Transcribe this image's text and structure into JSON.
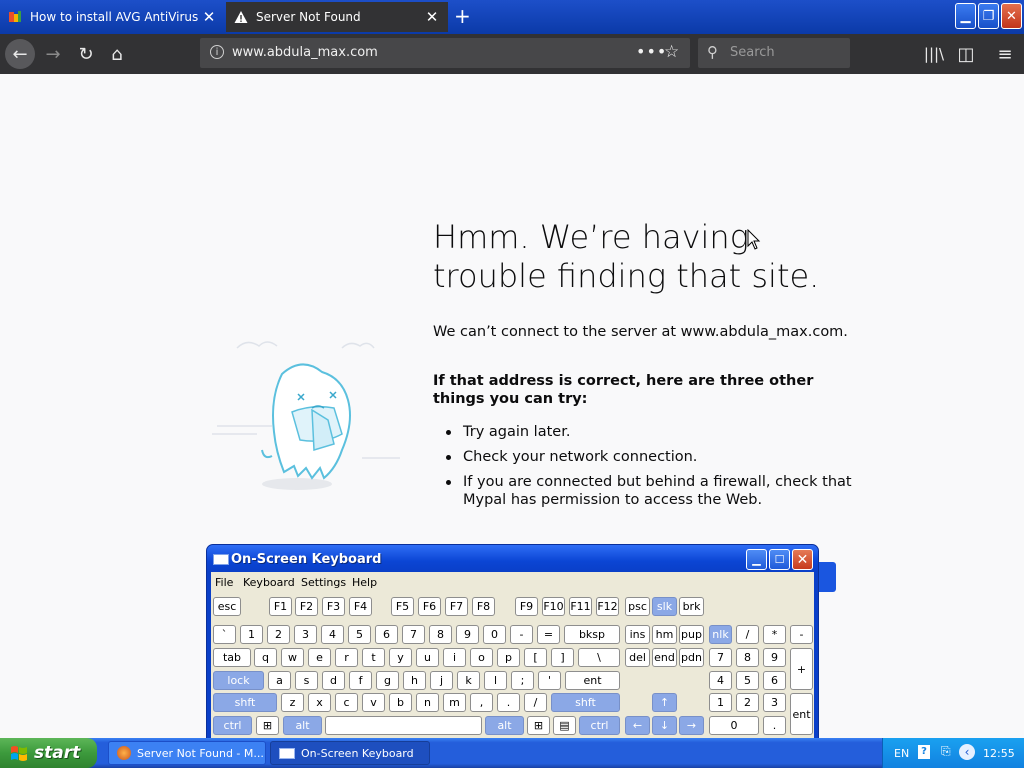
{
  "browser": {
    "tabs": [
      {
        "label": "How to install AVG AntiVirus | AVG",
        "active": false,
        "icon": "avg-favicon-icon"
      },
      {
        "label": "Server Not Found",
        "active": true,
        "icon": "warning-icon"
      }
    ],
    "url": "www.abdula_max.com",
    "search_placeholder": "Search",
    "colors": {
      "titlebar": "#0b3aa8",
      "toolbar": "#323234",
      "urlbar": "#474749"
    }
  },
  "page": {
    "title": "Hmm. We’re having trouble finding that site.",
    "message": "We can’t connect to the server at www.abdula_max.com.",
    "subheading": "If that address is correct, here are three other things you can try:",
    "tips": [
      "Try again later.",
      "Check your network connection.",
      "If you are connected but behind a firewall, check that Mypal has permission to access the Web."
    ]
  },
  "osk": {
    "title": "On-Screen Keyboard",
    "menu": [
      "File",
      "Keyboard",
      "Settings",
      "Help"
    ],
    "colors": {
      "frame": "#0a3fc8",
      "body": "#ece9d8",
      "accent_key": "#8ba8e6"
    }
  },
  "taskbar": {
    "start_label": "start",
    "buttons": [
      {
        "label": "Server Not Found - M...",
        "icon": "browser-icon"
      },
      {
        "label": "On-Screen Keyboard",
        "icon": "keyboard-icon"
      }
    ],
    "language": "EN",
    "clock": "12:55"
  }
}
